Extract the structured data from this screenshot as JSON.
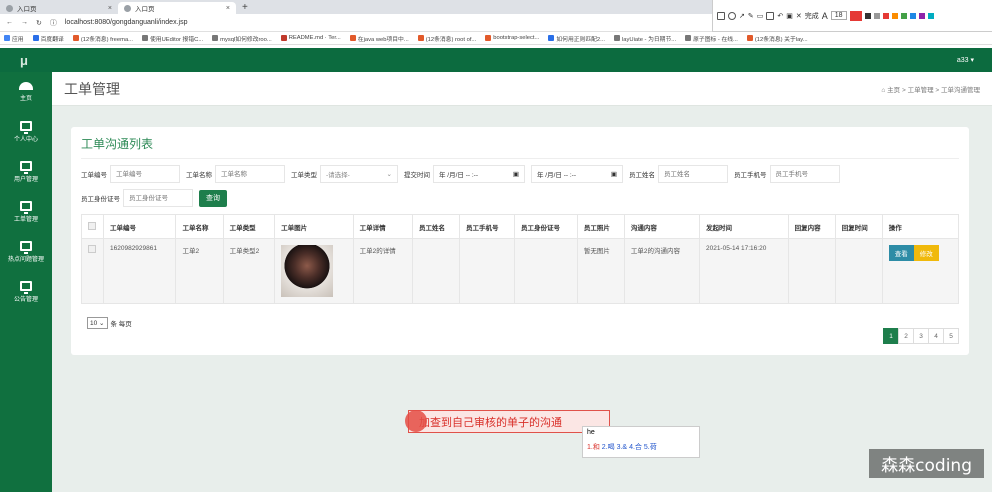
{
  "browser": {
    "tabs": [
      {
        "label": "入口页"
      },
      {
        "label": "入口页"
      }
    ],
    "url": "localhost:8080/gongdanguanli/index.jsp",
    "bookmarks": [
      "应用",
      "百度翻译",
      "(12条消息) freema...",
      "使用UEditor 报错C...",
      "mysql如何修改roo...",
      "README.md · Ter...",
      "在java web项目中...",
      "(12条消息) root of...",
      "bootstrap-select...",
      "如何用正则匹配2...",
      "layUiate - 为日期节...",
      "原子图标 - 在线...",
      "(12条消息) 关于lay..."
    ],
    "annot_label": "完成",
    "font_size": "18"
  },
  "topnav": {
    "logo": "μ",
    "user": "a33 ▾"
  },
  "sidebar": [
    {
      "label": "主页",
      "icon": "dashboard-icon"
    },
    {
      "label": "个人中心",
      "icon": "monitor-icon"
    },
    {
      "label": "用户管理",
      "icon": "monitor-icon"
    },
    {
      "label": "工单管理",
      "icon": "monitor-icon"
    },
    {
      "label": "热点问题管理",
      "icon": "monitor-icon"
    },
    {
      "label": "公告管理",
      "icon": "monitor-icon"
    }
  ],
  "page": {
    "title": "工单管理",
    "breadcrumb": [
      "主页",
      "工单管理",
      "工单沟通管理"
    ]
  },
  "card": {
    "title": "工单沟通列表",
    "filters": {
      "order_no": {
        "label": "工单编号",
        "placeholder": "工单编号"
      },
      "order_name": {
        "label": "工单名称",
        "placeholder": "工单名称"
      },
      "order_type": {
        "label": "工单类型",
        "value": "-请选择-"
      },
      "submit_time": {
        "label": "提交时间",
        "start": "年 /月/日 -- :--",
        "end": "年 /月/日 -- :--"
      },
      "emp_name": {
        "label": "员工姓名",
        "placeholder": "员工姓名"
      },
      "emp_phone": {
        "label": "员工手机号",
        "placeholder": "员工手机号"
      },
      "emp_id": {
        "label": "员工身份证号",
        "placeholder": "员工身份证号"
      },
      "query_label": "查询"
    },
    "columns": [
      "工单编号",
      "工单名称",
      "工单类型",
      "工单图片",
      "工单详情",
      "员工姓名",
      "员工手机号",
      "员工身份证号",
      "员工照片",
      "沟通内容",
      "发起时间",
      "回复内容",
      "回复时间",
      "操作"
    ],
    "rows": [
      {
        "no": "1620982929861",
        "name": "工单2",
        "type": "工单类型2",
        "detail": "工单2的详情",
        "emp_name": "",
        "emp_phone": "",
        "emp_id": "",
        "emp_photo": "暂无图片",
        "content": "工单2的沟通内容",
        "time": "2021-05-14 17:16:20",
        "reply": "",
        "reply_time": "",
        "view": "查看",
        "edit": "修改"
      }
    ],
    "page_size": "10",
    "page_size_suffix": "条 每页",
    "pages": [
      "1",
      "2",
      "3",
      "4",
      "5"
    ]
  },
  "overlay": {
    "tip": "加查到自己审核的单子的沟通",
    "ime_input": "he",
    "ime_candidates": [
      "1.和",
      "2.喝",
      "3.&",
      "4.合",
      "5.荷"
    ],
    "watermark": "森森coding"
  }
}
